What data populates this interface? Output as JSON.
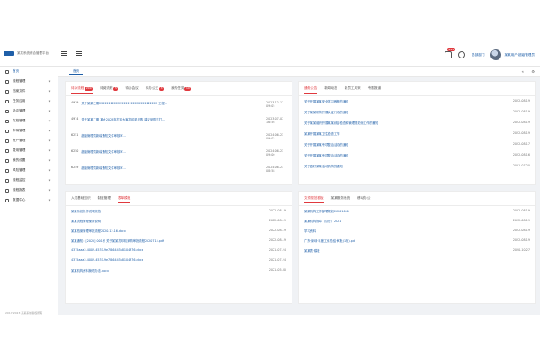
{
  "header": {
    "logo_text": "某某系统综合管理平台",
    "notify_badge": "99+",
    "dept": "总部部门",
    "user": "某某用户·超级管理员"
  },
  "sidebar": {
    "items": [
      {
        "label": "首页"
      },
      {
        "label": "流程管理"
      },
      {
        "label": "档案文件"
      },
      {
        "label": "任务应用"
      },
      {
        "label": "协议管理"
      },
      {
        "label": "文档管理"
      },
      {
        "label": "车辆管理"
      },
      {
        "label": "资产管理"
      },
      {
        "label": "费用管理"
      },
      {
        "label": "我的设置"
      },
      {
        "label": "风险管理"
      },
      {
        "label": "流程监控"
      },
      {
        "label": "流程报表"
      },
      {
        "label": "数据中心"
      }
    ],
    "footer": "2017-2023 某某系统版权所有"
  },
  "tags": {
    "home": "首页"
  },
  "panel_tasks": {
    "tabs": [
      {
        "label": "待办流程",
        "badge": "200"
      },
      {
        "label": "待阅流程",
        "badge": "5"
      },
      {
        "label": "待办会议",
        "badge": ""
      },
      {
        "label": "待办公文",
        "badge": "3"
      },
      {
        "label": "我的任务",
        "badge": "10"
      }
    ],
    "rows": [
      {
        "num": "4979",
        "text": "关于某某二期2222222222222222222222222222222 工程报告审核审批单",
        "date": "2023-12-17 09:05"
      },
      {
        "num": "4974",
        "text": "关于某某二期 某大2023年打印大客打印机采购 建议采购方打印审核审批单",
        "date": "2023-07-07 16:56"
      },
      {
        "num": "6251",
        "text": "超级管理员新增通知文件审核审批单",
        "date": "2024-06-23 09:02"
      },
      {
        "num": "6250",
        "text": "超级管理员新增通知文件审核审批单",
        "date": "2024-06-23 09:00"
      },
      {
        "num": "6249",
        "text": "超级管理员新增通知文件审核审批单",
        "date": "2024-06-23 08:58"
      }
    ]
  },
  "panel_notice": {
    "tabs": [
      {
        "label": "通知公告"
      },
      {
        "label": "新闻动态"
      },
      {
        "label": "新员工风采"
      },
      {
        "label": "专题报道"
      }
    ],
    "rows": [
      {
        "text": "关于开展某某安全学习教育的通知",
        "date": "2022-08-19"
      },
      {
        "text": "关于某某机构开展认证行动的通知",
        "date": "2022-08-19"
      },
      {
        "text": "关于某某组织开展某某综合检查和管理规范化工作的通知",
        "date": "2022-08-19"
      },
      {
        "text": "某某开展某某卫生检查工作",
        "date": "2022-08-19"
      },
      {
        "text": "关于开展某某专项整治活动的通知",
        "date": "2022-08-17"
      },
      {
        "text": "关于开展某某专项整治活动的通知",
        "date": "2022-08-16"
      },
      {
        "text": "关于做好某某活动机构的通知",
        "date": "2021-07-20"
      }
    ]
  },
  "panel_files": {
    "tabs": [
      {
        "label": "入门基础知识"
      },
      {
        "label": "制度管理"
      },
      {
        "label": "表单模板"
      }
    ],
    "rows": [
      {
        "text": "某某系统操作说明文档",
        "date": "2022-08-19"
      },
      {
        "text": "某某流程管理使用说明",
        "date": "2022-08-19"
      },
      {
        "text": "某某档案管理审批流程2020.12.16.docx",
        "date": "2022-08-19"
      },
      {
        "text": "某某通知：[2020] 001号 关于某某打印机采购审批流程2020715.pdf",
        "date": "2022-08-19"
      },
      {
        "text": "4375aaa2-4009-4537-9e78-6445a8104376.docx",
        "date": "2021-07-24"
      },
      {
        "text": "4375aaa2-4009-4537-9e78-6445a8104376.docx",
        "date": "2021-07-24"
      },
      {
        "text": "某某机构资料管理办法.docx",
        "date": "2021-05-30"
      }
    ]
  },
  "panel_links": {
    "tabs": [
      {
        "label": "文件规范模板"
      },
      {
        "label": "某某服务系统"
      },
      {
        "label": "移动办公"
      }
    ],
    "rows": [
      {
        "text": "某某机构工作部署规划20201030",
        "date": "2022-08-19"
      },
      {
        "text": "某某机构规章（试行）2021",
        "date": "2022-08-19"
      },
      {
        "text": "学习资料",
        "date": "2022-08-19"
      },
      {
        "text": "广东·深圳·年度工作总结·审批(1页).pdf",
        "date": "2022-08-19"
      },
      {
        "text": "某某表·模板",
        "date": "2020-10-27"
      }
    ]
  }
}
